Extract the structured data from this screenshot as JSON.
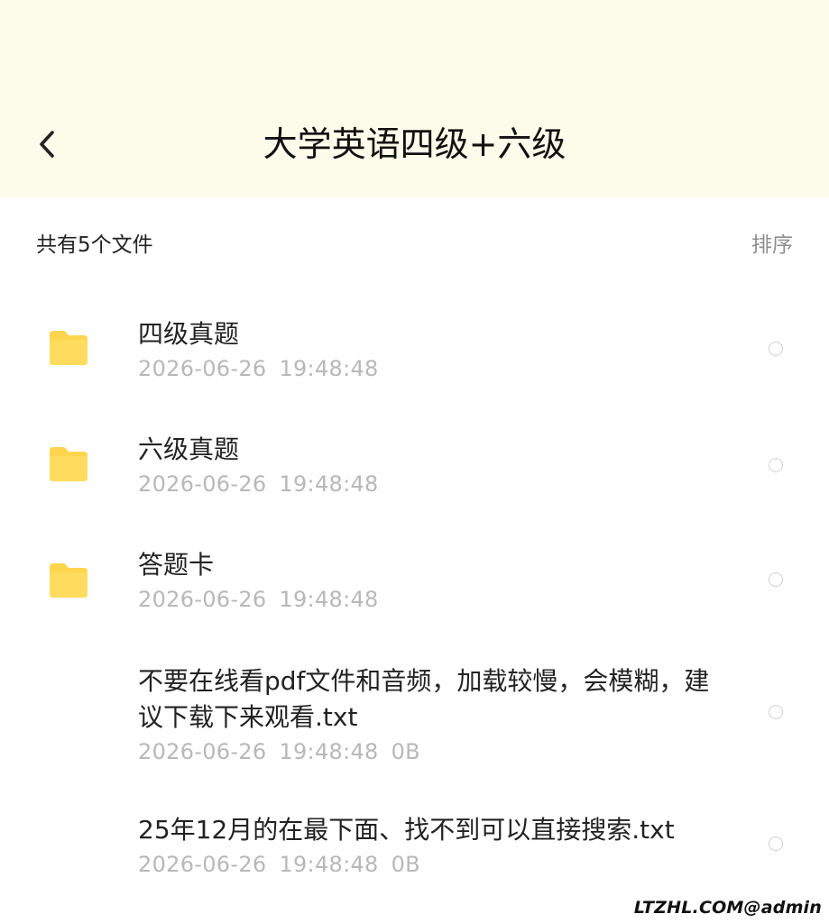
{
  "header": {
    "title": "大学英语四级+六级",
    "back_icon": "chevron-left-icon"
  },
  "toolbar": {
    "summary": "共有5个文件",
    "sort_label": "排序"
  },
  "files": [
    {
      "name": "四级真题",
      "date": "2026-06-26",
      "time": "19:48:48",
      "size": "",
      "type": "folder"
    },
    {
      "name": "六级真题",
      "date": "2026-06-26",
      "time": "19:48:48",
      "size": "",
      "type": "folder"
    },
    {
      "name": "答题卡",
      "date": "2026-06-26",
      "time": "19:48:48",
      "size": "",
      "type": "folder"
    },
    {
      "name": "不要在线看pdf文件和音频，加载较慢，会模糊，建议下载下来观看.txt",
      "date": "2026-06-26",
      "time": "19:48:48",
      "size": "0B",
      "type": "file"
    },
    {
      "name": "25年12月的在最下面、找不到可以直接搜索.txt",
      "date": "2026-06-26",
      "time": "19:48:48",
      "size": "0B",
      "type": "file"
    }
  ],
  "watermark": "LTZHL.COM@admin",
  "colors": {
    "header_bg": "#fdfbe9",
    "folder": "#ffd54f",
    "muted_text": "#b8b8b8",
    "sort_text": "#8e8e8e"
  }
}
